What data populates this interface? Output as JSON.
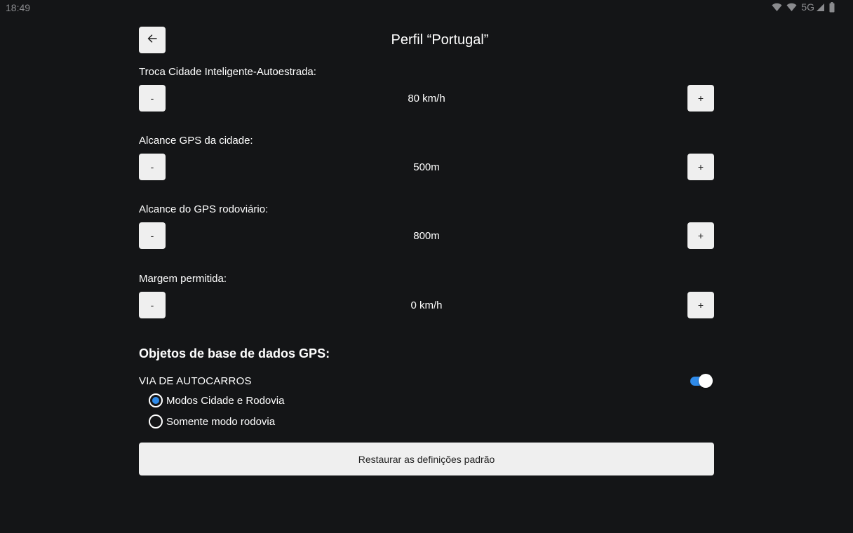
{
  "status_bar": {
    "time": "18:49",
    "network": "5G",
    "icons": [
      "wifi-icon",
      "wifi-icon",
      "cellular-signal-icon",
      "battery-icon"
    ]
  },
  "header": {
    "back_icon": "arrow-left-icon",
    "title": "Perfil “Portugal”"
  },
  "settings": [
    {
      "label": "Troca Cidade Inteligente-Autoestrada:",
      "value": "80 km/h",
      "minus": "-",
      "plus": "+"
    },
    {
      "label": "Alcance GPS da cidade:",
      "value": "500m",
      "minus": "-",
      "plus": "+"
    },
    {
      "label": "Alcance do GPS rodoviário:",
      "value": "800m",
      "minus": "-",
      "plus": "+"
    },
    {
      "label": "Margem permitida:",
      "value": "0 km/h",
      "minus": "-",
      "plus": "+"
    }
  ],
  "gps_objects": {
    "section_title": "Objetos de base de dados GPS:",
    "feature_label": "VIA DE AUTOCARROS",
    "feature_enabled": true,
    "options": [
      {
        "label": "Modos Cidade e Rodovia",
        "selected": true
      },
      {
        "label": "Somente modo rodovia",
        "selected": false
      }
    ]
  },
  "reset_button": "Restaurar as definições padrão",
  "colors": {
    "background": "#141517",
    "button": "#efefef",
    "accent": "#2f8bea"
  }
}
